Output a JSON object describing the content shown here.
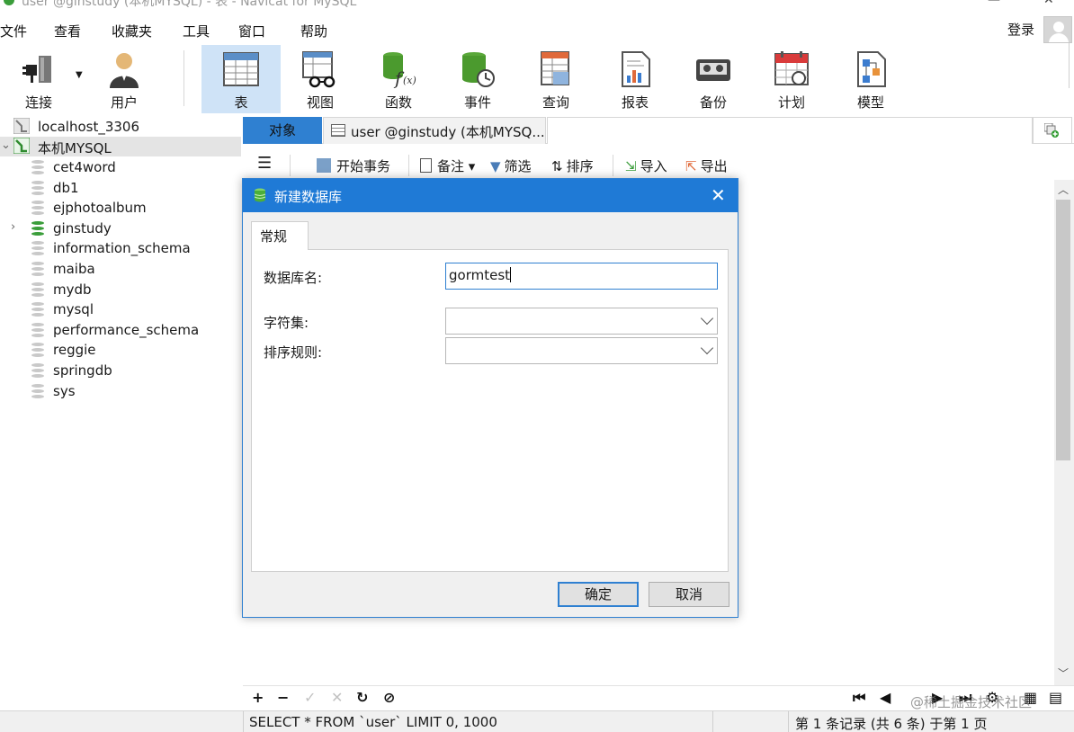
{
  "window": {
    "title": "user @ginstudy (本机MYSQL) - 表 - Navicat for MySQL"
  },
  "menu": [
    "文件",
    "查看",
    "收藏夹",
    "工具",
    "窗口",
    "帮助"
  ],
  "login_label": "登录",
  "toolbar": [
    {
      "label": "连接",
      "icon": "plug-icon"
    },
    {
      "label": "用户",
      "icon": "user-icon"
    },
    {
      "label": "表",
      "icon": "table-icon",
      "active": true
    },
    {
      "label": "视图",
      "icon": "view-icon"
    },
    {
      "label": "函数",
      "icon": "function-icon"
    },
    {
      "label": "事件",
      "icon": "event-icon"
    },
    {
      "label": "查询",
      "icon": "query-icon"
    },
    {
      "label": "报表",
      "icon": "report-icon"
    },
    {
      "label": "备份",
      "icon": "backup-icon"
    },
    {
      "label": "计划",
      "icon": "schedule-icon"
    },
    {
      "label": "模型",
      "icon": "model-icon"
    }
  ],
  "tree": {
    "connections": [
      {
        "name": "localhost_3306",
        "open": false
      },
      {
        "name": "本机MYSQL",
        "open": true,
        "selected": true
      }
    ],
    "databases": [
      {
        "name": "cet4word",
        "active": false
      },
      {
        "name": "db1",
        "active": false
      },
      {
        "name": "ejphotoalbum",
        "active": false
      },
      {
        "name": "ginstudy",
        "active": true
      },
      {
        "name": "information_schema",
        "active": false
      },
      {
        "name": "maiba",
        "active": false
      },
      {
        "name": "mydb",
        "active": false
      },
      {
        "name": "mysql",
        "active": false
      },
      {
        "name": "performance_schema",
        "active": false
      },
      {
        "name": "reggie",
        "active": false
      },
      {
        "name": "springdb",
        "active": false
      },
      {
        "name": "sys",
        "active": false
      }
    ]
  },
  "tabs": {
    "objects": "对象",
    "user": "user @ginstudy (本机MYSQ..."
  },
  "table_toolbar": {
    "begin_transaction": "开始事务",
    "note": "备注",
    "filter": "筛选",
    "sort": "排序",
    "import": "导入",
    "export": "导出"
  },
  "dialog": {
    "title": "新建数据库",
    "tab": "常规",
    "db_name_label": "数据库名:",
    "db_name_value": "gormtest",
    "charset_label": "字符集:",
    "charset_value": "",
    "collation_label": "排序规则:",
    "collation_value": "",
    "ok": "确定",
    "cancel": "取消"
  },
  "status": {
    "sql": "SELECT * FROM `user` LIMIT 0, 1000",
    "records": "第 1 条记录 (共 6 条) 于第 1 页"
  },
  "watermark": "@稀土掘金技术社区",
  "colors": {
    "accent": "#1f7ad6",
    "toolbar_active": "#cfe3f7",
    "db_active": "#3a9d3a",
    "db_inactive": "#c9c9c9"
  }
}
